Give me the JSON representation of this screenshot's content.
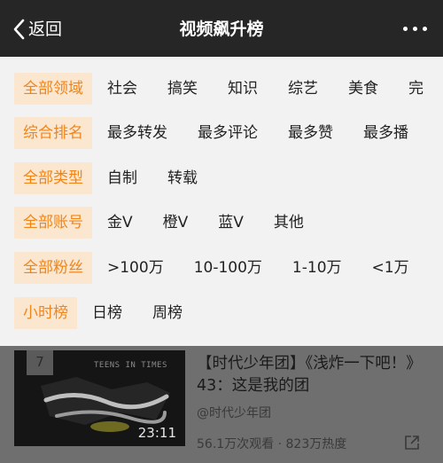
{
  "header": {
    "back_label": "返回",
    "title": "视频飙升榜"
  },
  "filters": [
    {
      "selected": "全部领域",
      "options": [
        "社会",
        "搞笑",
        "知识",
        "综艺",
        "美食",
        "完"
      ]
    },
    {
      "selected": "综合排名",
      "options": [
        "最多转发",
        "最多评论",
        "最多赞",
        "最多播"
      ]
    },
    {
      "selected": "全部类型",
      "options": [
        "自制",
        "转载"
      ]
    },
    {
      "selected": "全部账号",
      "options": [
        "金V",
        "橙V",
        "蓝V",
        "其他"
      ]
    },
    {
      "selected": "全部粉丝",
      "options": [
        ">100万",
        "10-100万",
        "1-10万",
        "<1万"
      ]
    },
    {
      "selected": "小时榜",
      "options": [
        "日榜",
        "周榜"
      ]
    }
  ],
  "video": {
    "rank": "7",
    "brand": "TEENS IN TIMES",
    "duration": "23:11",
    "title": "【时代少年团】《浅炸一下吧！》43：这是我的团",
    "author": "@时代少年团",
    "stats": "56.1万次观看 · 823万热度"
  },
  "colors": {
    "header_bg": "#262626",
    "panel_bg": "#f2f2f2",
    "chip_bg": "#fbe6d0",
    "accent": "#f08519",
    "overlay": "#6f6f6f"
  },
  "icons": {
    "back": "chevron-left-icon",
    "more": "more-horizontal-icon",
    "share": "share-icon"
  }
}
